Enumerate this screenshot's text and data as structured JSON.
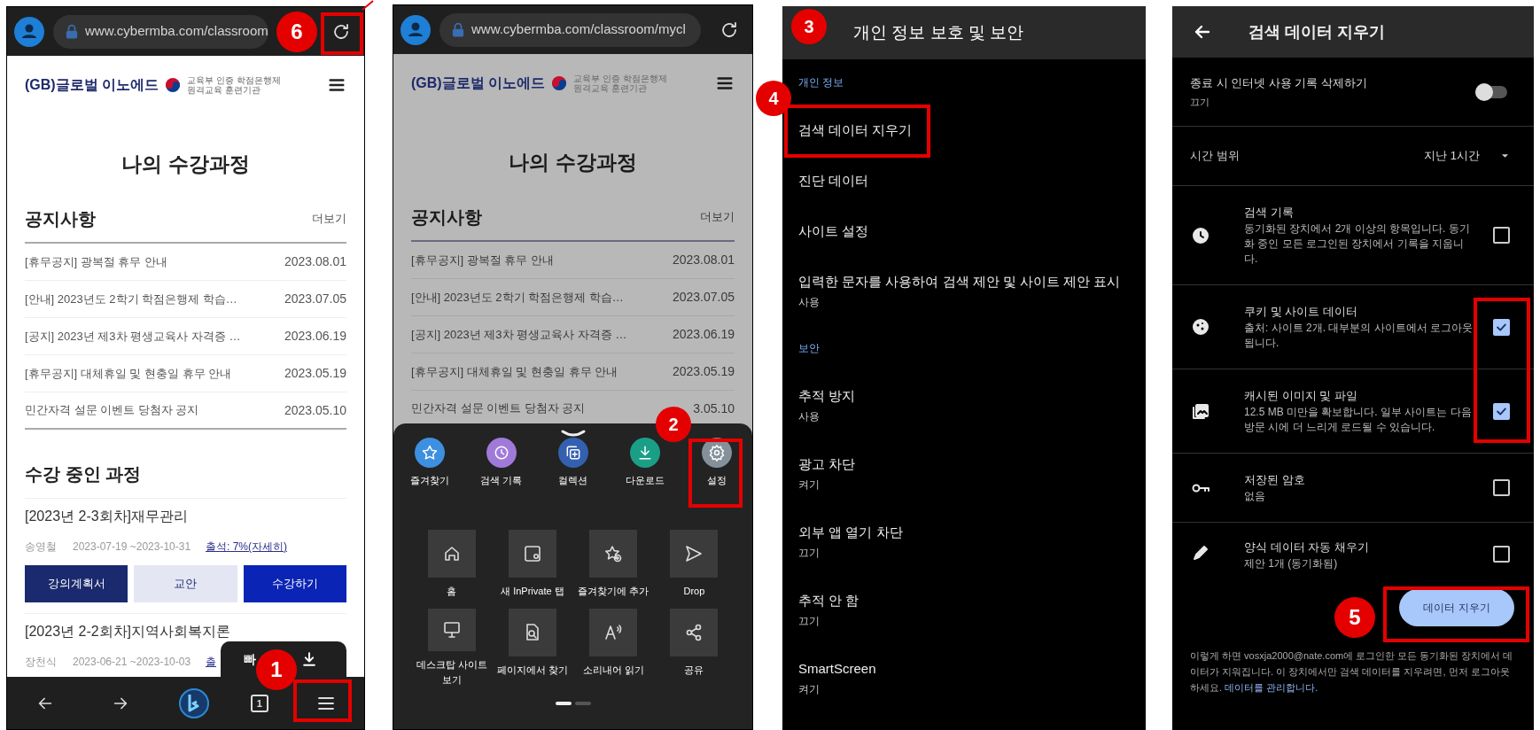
{
  "browser_panel": {
    "url": "www.cybermba.com/classroom",
    "page": {
      "logo": "(GB)글로벌 이노에드",
      "logo_caption": [
        "교육부 인증 학점은행제",
        "원격교육 훈련기관"
      ],
      "title": "나의 수강과정",
      "notice_heading": "공지사항",
      "more_link": "더보기",
      "notices": [
        {
          "title": "[휴무공지] 광복절 휴무 안내",
          "date": "2023.08.01"
        },
        {
          "title": "[안내] 2023년도 2학기 학점은행제 학습…",
          "date": "2023.07.05"
        },
        {
          "title": "[공지] 2023년 제3차 평생교육사 자격증 …",
          "date": "2023.06.19"
        },
        {
          "title": "[휴무공지] 대체휴일 및 현충일 휴무 안내",
          "date": "2023.05.19"
        },
        {
          "title": "민간자격 설문 이벤트 당첨자 공지",
          "date": "2023.05.10"
        }
      ],
      "courses_heading": "수강 중인 과정",
      "courses": [
        {
          "title": "[2023년 2-3회차]재무관리",
          "teacher": "송영철",
          "period": "2023-07-19 ~2023-10-31",
          "attendance": "출석: 7%(자세히)",
          "buttons": [
            {
              "label": "강의계획서",
              "kind": "dark"
            },
            {
              "label": "교안",
              "kind": "light"
            },
            {
              "label": "수강하기",
              "kind": "blue"
            }
          ]
        },
        {
          "title": "[2023년 2-2회차]지역사회복지론",
          "teacher": "장천식",
          "period": "2023-06-21 ~2023-10-03",
          "attendance": "출"
        }
      ]
    },
    "toast": "빠",
    "bottom_nav": [
      {
        "kind": "back"
      },
      {
        "kind": "forward"
      },
      {
        "kind": "bing"
      },
      {
        "kind": "tabs",
        "label": "1"
      },
      {
        "kind": "menu"
      }
    ]
  },
  "menu_panel": {
    "url": "www.cybermba.com/classroom/mycl",
    "page": {
      "dimmed": true,
      "logo": "(GB)글로벌 이노에드",
      "logo_caption": [
        "교육부 인증 학점은행제",
        "원격교육 훈련기관"
      ],
      "title": "나의 수강과정",
      "notice_heading": "공지사항",
      "more_link": "더보기",
      "notices": [
        {
          "title": "[휴무공지] 광복절 휴무 안내",
          "date": "2023.08.01"
        },
        {
          "title": "[안내] 2023년도 2학기 학점은행제 학습…",
          "date": "2023.07.05"
        },
        {
          "title": "[공지] 2023년 제3차 평생교육사 자격증 …",
          "date": "2023.06.19"
        },
        {
          "title": "[휴무공지] 대체휴일 및 현충일 휴무 안내",
          "date": "2023.05.19"
        },
        {
          "title": "민간자격 설문 이벤트 당첨자 공지",
          "date": "3.05.10"
        }
      ]
    },
    "quick_actions": [
      {
        "kind": "star",
        "label": "즐겨찾기",
        "color": "#3d8fe0"
      },
      {
        "kind": "history",
        "label": "검색 기록",
        "color": "#a07ad8"
      },
      {
        "kind": "collections",
        "label": "컬렉션",
        "color": "#3460b0"
      },
      {
        "kind": "download",
        "label": "다운로드",
        "color": "#1a9f87"
      },
      {
        "kind": "gear",
        "label": "설정",
        "color": "#84919a"
      }
    ],
    "tiles": [
      {
        "kind": "home",
        "label": "홈"
      },
      {
        "kind": "private_tab",
        "label": "새 InPrivate 탭"
      },
      {
        "kind": "star_add",
        "label": "즐겨찾기에 추가"
      },
      {
        "kind": "send",
        "label": "Drop"
      },
      {
        "kind": "monitor",
        "label": "데스크탑 사이트 보기"
      },
      {
        "kind": "find",
        "label": "페이지에서 찾기"
      },
      {
        "kind": "read_aloud",
        "label": "소리내어 읽기"
      },
      {
        "kind": "share",
        "label": "공유"
      }
    ]
  },
  "settings_panel": {
    "title": "개인 정보 보호 및 보안",
    "sections": [
      {
        "heading": "개인 정보",
        "items": [
          {
            "title": "검색 데이터 지우기"
          },
          {
            "title": "진단 데이터"
          },
          {
            "title": "사이트 설정"
          },
          {
            "title": "입력한 문자를 사용하여 검색 제안 및 사이트 제안 표시",
            "value": "사용"
          }
        ]
      },
      {
        "heading": "보안",
        "items": [
          {
            "title": "추적 방지",
            "value": "사용"
          },
          {
            "title": "광고 차단",
            "value": "켜기"
          },
          {
            "title": "외부 앱 열기 차단",
            "value": "끄기"
          },
          {
            "title": "추적 안 함",
            "value": "끄기"
          },
          {
            "title": "SmartScreen",
            "value": "켜기"
          }
        ]
      }
    ]
  },
  "clear_data_panel": {
    "title": "검색 데이터 지우기",
    "exit_toggle": {
      "title": "종료 시 인터넷 사용 기록 삭제하기",
      "value": "끄기",
      "on": false
    },
    "time_range": {
      "label": "시간 범위",
      "value": "지난 1시간"
    },
    "data_types": [
      {
        "kind": "clock",
        "title": "검색 기록",
        "description": "동기화된 장치에서 2개 이상의 항목입니다. 동기화 중인 모든 로그인된 장치에서 기록을 지웁니다.",
        "checked": false
      },
      {
        "kind": "cookie",
        "title": "쿠키 및 사이트 데이터",
        "description": "출처: 사이트 2개. 대부분의 사이트에서 로그아웃됩니다.",
        "checked": true
      },
      {
        "kind": "image",
        "title": "캐시된 이미지 및 파일",
        "description": "12.5 MB 미만을 확보합니다. 일부 사이트는 다음 방문 시에 더 느리게 로드될 수 있습니다.",
        "checked": true
      },
      {
        "kind": "key",
        "title": "저장된 암호",
        "description": "없음",
        "checked": false
      },
      {
        "kind": "pencil",
        "title": "양식 데이터 자동 채우기",
        "description": "제안 1개 (동기화됨)",
        "checked": false
      }
    ],
    "clear_button": "데이터 지우기",
    "footer_text": "이렇게 하면 vosxja2000@nate.com에 로그인한 모든 동기화된 장치에서 데이터가 지워집니다. 이 장치에서만 검색 데이터를 지우려면, 먼저 로그아웃하세요.",
    "footer_link": "데이터를 관리합니다."
  },
  "step_badges": [
    {
      "number": "6"
    },
    {
      "number": "1"
    },
    {
      "number": "2"
    },
    {
      "number": "3"
    },
    {
      "number": "4"
    },
    {
      "number": "5"
    }
  ]
}
